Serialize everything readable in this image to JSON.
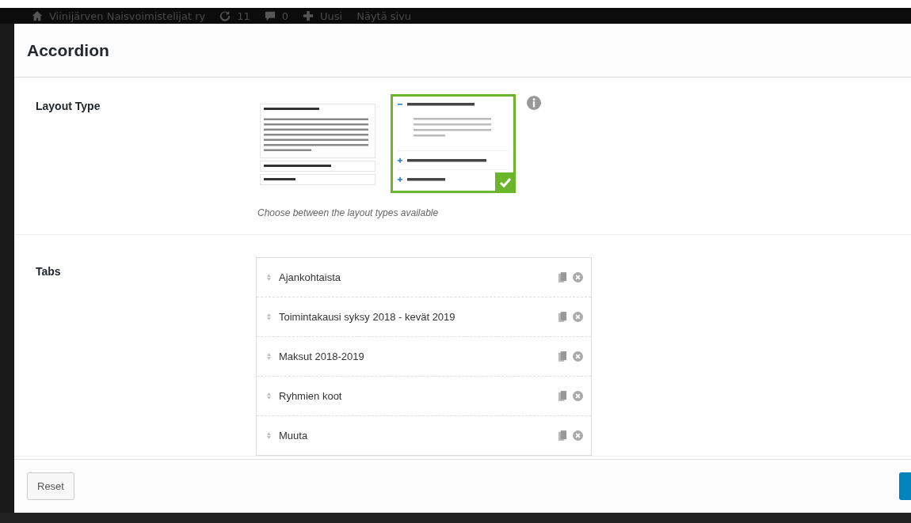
{
  "admin_bar": {
    "site_name": "Viinijärven Naisvoimistelijat ry",
    "updates": "11",
    "comments": "0",
    "new": "Uusi",
    "view": "Näytä sivu"
  },
  "dialog": {
    "title": "Accordion"
  },
  "layout_type": {
    "label": "Layout Type",
    "caption": "Choose between the layout types available",
    "options": [
      {
        "kind": "boxed",
        "selected": false
      },
      {
        "kind": "icons",
        "selected": true
      }
    ]
  },
  "tabs": {
    "label": "Tabs",
    "items": [
      {
        "title": "Ajankohtaista"
      },
      {
        "title": "Toimintakausi syksy 2018 - kevät 2019"
      },
      {
        "title": "Maksut 2018-2019"
      },
      {
        "title": "Ryhmien koot"
      },
      {
        "title": "Muuta"
      }
    ]
  },
  "footer": {
    "reset": "Reset"
  }
}
